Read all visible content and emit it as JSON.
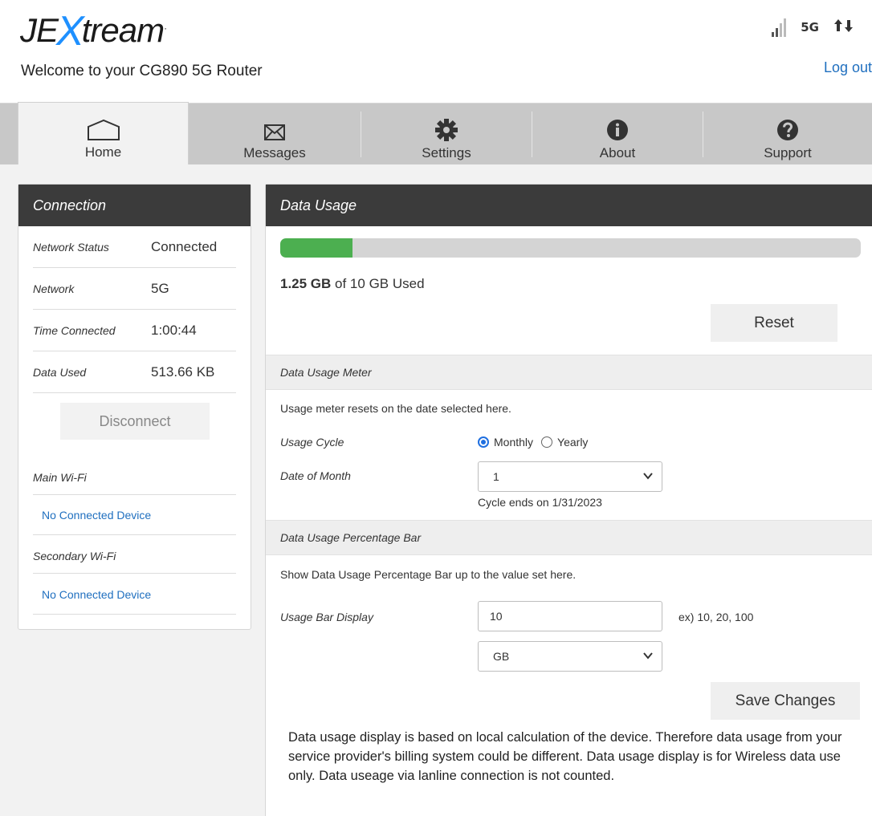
{
  "header": {
    "logo_left": "JE",
    "logo_x": "X",
    "logo_right": "tream",
    "logo_tm": "·",
    "welcome": "Welcome to your CG890 5G Router",
    "network_type": "5G",
    "logout": "Log out",
    "signal_bars_lit": 2,
    "signal_bars_total": 4
  },
  "tabs": [
    {
      "label": "Home",
      "icon": "home-icon"
    },
    {
      "label": "Messages",
      "icon": "envelope-icon"
    },
    {
      "label": "Settings",
      "icon": "gear-icon"
    },
    {
      "label": "About",
      "icon": "info-icon"
    },
    {
      "label": "Support",
      "icon": "question-icon"
    }
  ],
  "connection": {
    "title": "Connection",
    "rows": [
      {
        "key": "Network Status",
        "value": "Connected"
      },
      {
        "key": "Network",
        "value": "5G"
      },
      {
        "key": "Time Connected",
        "value": "1:00:44"
      },
      {
        "key": "Data Used",
        "value": "513.66 KB"
      }
    ],
    "disconnect_label": "Disconnect",
    "main_wifi_label": "Main Wi-Fi",
    "main_wifi_device": "No Connected Device",
    "secondary_wifi_label": "Secondary Wi-Fi",
    "secondary_wifi_device": "No Connected Device"
  },
  "data_usage": {
    "title": "Data Usage",
    "used_amount": "1.25 GB",
    "used_suffix": " of 10 GB Used",
    "used_fraction": 0.125,
    "reset_label": "Reset",
    "meter": {
      "section_title": "Data Usage Meter",
      "description": "Usage meter resets on the date selected here.",
      "cycle_label": "Usage Cycle",
      "cycle_options": [
        "Monthly",
        "Yearly"
      ],
      "cycle_selected": "Monthly",
      "date_label": "Date of Month",
      "date_value": "1",
      "cycle_end": "Cycle ends on 1/31/2023"
    },
    "bar_section": {
      "section_title": "Data Usage Percentage Bar",
      "description": "Show Data Usage Percentage Bar up to the value set here.",
      "display_label": "Usage Bar Display",
      "display_value": "10",
      "display_hint": "ex) 10, 20, 100",
      "unit_value": "GB"
    },
    "save_label": "Save Changes",
    "note": "Data usage display is based on local calculation of the device. Therefore data usage from your service provider's billing system could be different. Data usage display is for Wireless data use only. Data useage via lanline connection is not counted."
  },
  "colors": {
    "accent_blue": "#1f6fbf",
    "bar_fill": "#4caf50",
    "panel_header": "#3b3b3b"
  }
}
